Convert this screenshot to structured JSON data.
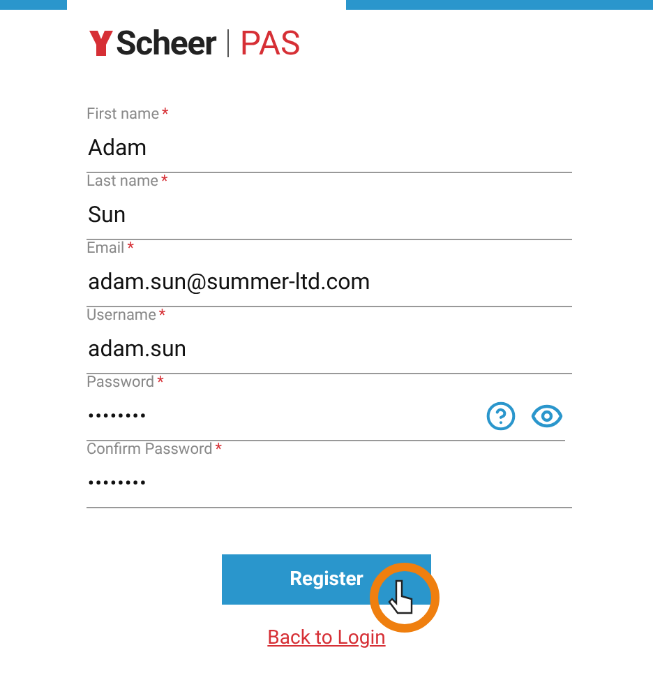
{
  "logo": {
    "brand": "Scheer",
    "product": "PAS"
  },
  "fields": [
    {
      "kind": "text",
      "label": "First name",
      "required_mark": "*",
      "value": "Adam"
    },
    {
      "kind": "text",
      "label": "Last name",
      "required_mark": "*",
      "value": "Sun"
    },
    {
      "kind": "text",
      "label": "Email",
      "required_mark": "*",
      "value": "adam.sun@summer-ltd.com"
    },
    {
      "kind": "text",
      "label": "Username",
      "required_mark": "*",
      "value": "adam.sun"
    },
    {
      "kind": "password",
      "label": "Password",
      "required_mark": "*",
      "value": "••••••••"
    },
    {
      "kind": "confirm",
      "label": "Confirm Password",
      "required_mark": "*",
      "value": "••••••••"
    }
  ],
  "register_button": "Register",
  "back_link": "Back to Login"
}
